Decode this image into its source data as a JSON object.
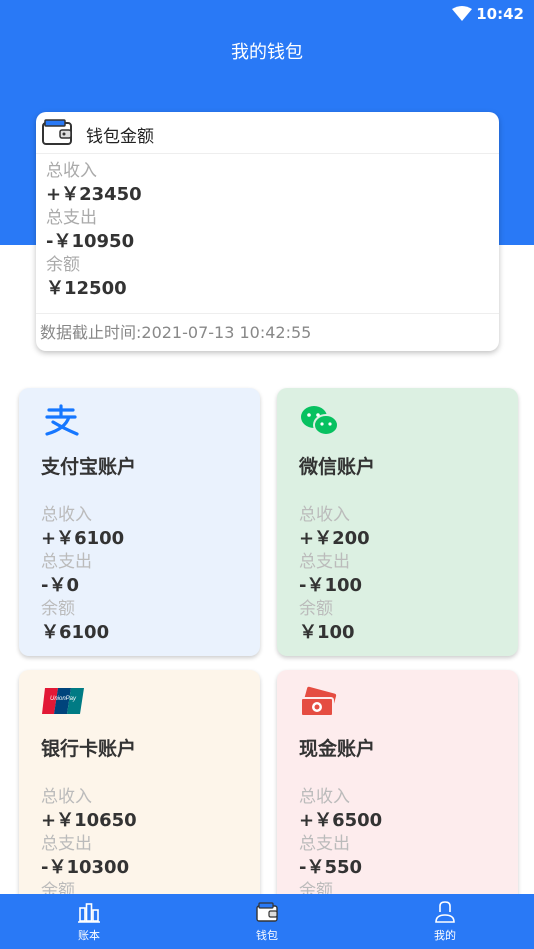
{
  "status": {
    "time": "10:42"
  },
  "header": {
    "title": "我的钱包"
  },
  "summary": {
    "heading": "钱包金额",
    "income_label": "总收入",
    "income_value": "+￥23450",
    "expense_label": "总支出",
    "expense_value": "-￥10950",
    "balance_label": "余额",
    "balance_value": "￥12500",
    "cutoff_text": "数据截止时间:2021-07-13 10:42:55"
  },
  "accounts": [
    {
      "title": "支付宝账户",
      "icon": "alipay-icon",
      "income_label": "总收入",
      "income": "+￥6100",
      "expense_label": "总支出",
      "expense": "-￥0",
      "balance_label": "余额",
      "balance": "￥6100"
    },
    {
      "title": "微信账户",
      "icon": "wechat-icon",
      "income_label": "总收入",
      "income": "+￥200",
      "expense_label": "总支出",
      "expense": "-￥100",
      "balance_label": "余额",
      "balance": "￥100"
    },
    {
      "title": "银行卡账户",
      "icon": "unionpay-icon",
      "income_label": "总收入",
      "income": "+￥10650",
      "expense_label": "总支出",
      "expense": "-￥10300",
      "balance_label": "余额",
      "balance": ""
    },
    {
      "title": "现金账户",
      "icon": "cash-icon",
      "income_label": "总收入",
      "income": "+￥6500",
      "expense_label": "总支出",
      "expense": "-￥550",
      "balance_label": "余额",
      "balance": ""
    }
  ],
  "nav": [
    {
      "label": "账本",
      "icon": "ledger-icon"
    },
    {
      "label": "钱包",
      "icon": "wallet-icon"
    },
    {
      "label": "我的",
      "icon": "profile-icon"
    }
  ],
  "colors": {
    "primary": "#2979f6",
    "alipay": "#1677ff",
    "wechat": "#07c160",
    "cash": "#e54d42"
  }
}
